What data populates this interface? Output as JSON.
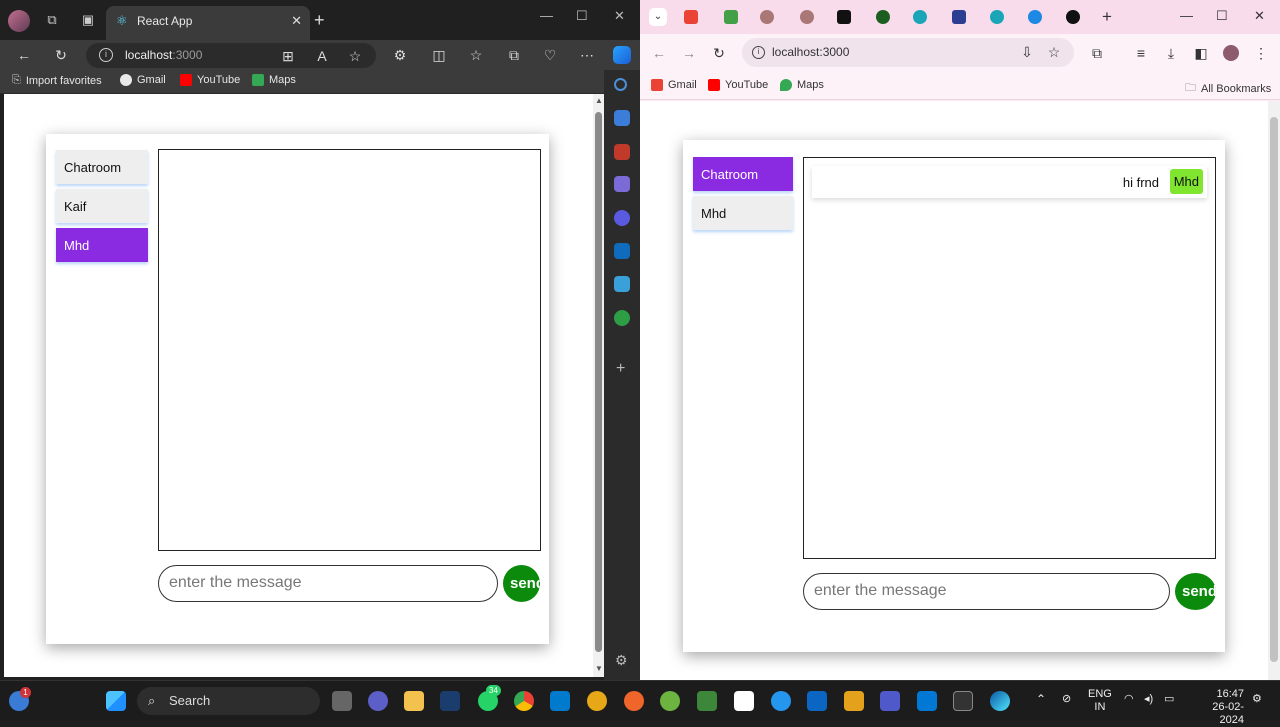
{
  "edge": {
    "tab_title": "React App",
    "url_host": "localhost",
    "url_port": ":3000",
    "bookmarks": [
      "Import favorites",
      "Gmail",
      "YouTube",
      "Maps"
    ]
  },
  "chrome": {
    "url": "localhost:3000",
    "bookmarks": [
      "Gmail",
      "YouTube",
      "Maps"
    ],
    "all_bookmarks": "All Bookmarks"
  },
  "left_app": {
    "nav": [
      "Chatroom",
      "Kaif",
      "Mhd"
    ],
    "active": "Mhd",
    "input_placeholder": "enter the message",
    "send_label": "send"
  },
  "right_app": {
    "nav": [
      "Chatroom",
      "Mhd"
    ],
    "active": "Chatroom",
    "messages": [
      {
        "text": "hi frnd",
        "sender": "Mhd"
      }
    ],
    "input_placeholder": "enter the message",
    "send_label": "send"
  },
  "taskbar": {
    "search_label": "Search",
    "badge_count": "34",
    "notif_count": "1",
    "lang_top": "ENG",
    "lang_bottom": "IN",
    "time": "16:47",
    "date": "26-02-2024"
  },
  "colors": {
    "active_nav": "#8a2be2",
    "send_button": "#0b8a0b",
    "sender_badge": "#7fe52e"
  }
}
